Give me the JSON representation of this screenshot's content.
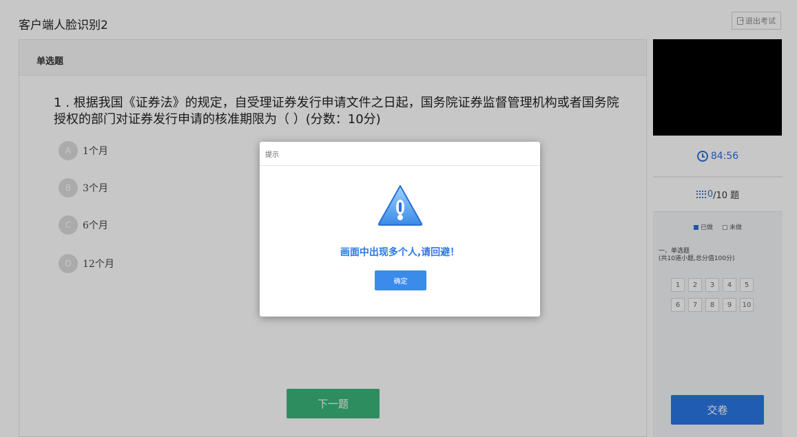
{
  "app": {
    "title": "客户端人脸识别2",
    "exit_label": "退出考试"
  },
  "section": {
    "title": "单选题"
  },
  "question": {
    "text": "1 . 根据我国《证券法》的规定，自受理证券发行申请文件之日起，国务院证券监督管理机构或者国务院授权的部门对证券发行申请的核准期限为（  ）(分数：10分)"
  },
  "options": [
    {
      "letter": "A",
      "text": "1个月"
    },
    {
      "letter": "B",
      "text": "3个月"
    },
    {
      "letter": "C",
      "text": "6个月"
    },
    {
      "letter": "D",
      "text": "12个月"
    }
  ],
  "next_label": "下一题",
  "sidebar": {
    "timer": "84:56",
    "progress": {
      "done": "0",
      "total_text": "/10 题"
    },
    "legend": {
      "done": "已做",
      "undone": "未做"
    },
    "group": {
      "title": "一、单选题",
      "subtitle": "(共10道小题,总分值100分)"
    },
    "numbers": [
      "1",
      "2",
      "3",
      "4",
      "5",
      "6",
      "7",
      "8",
      "9",
      "10"
    ],
    "submit_label": "交卷"
  },
  "modal": {
    "title": "提示",
    "message": "画面中出现多个人,请回避！",
    "ok_label": "确定",
    "icon": "warning-icon"
  },
  "colors": {
    "accent": "#2b77e6",
    "next_button": "#3cb57a",
    "camera": "#000000"
  }
}
